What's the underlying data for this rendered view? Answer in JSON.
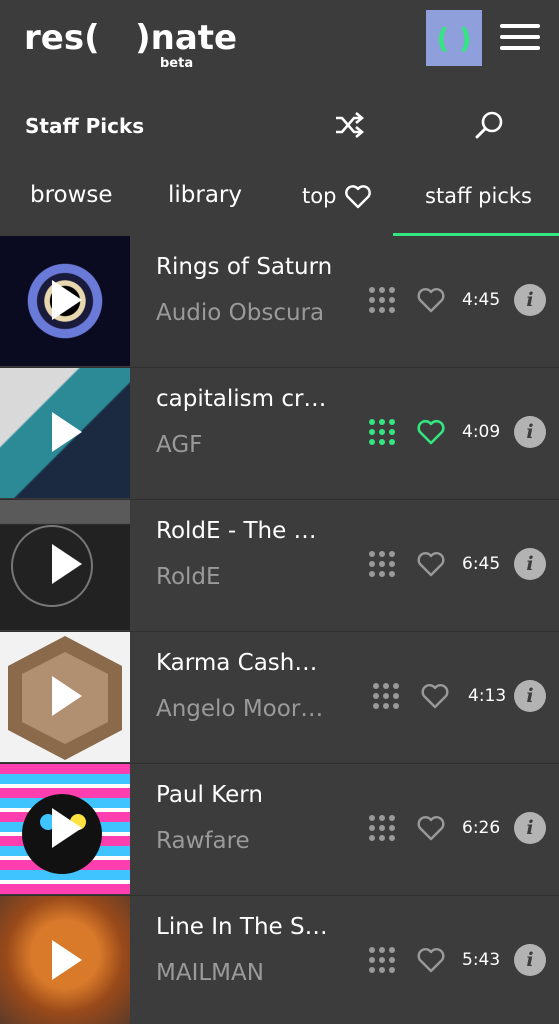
{
  "app": {
    "logo_text": "res(   )nate",
    "beta_label": "beta",
    "player_button_label": "( )"
  },
  "subbar": {
    "title": "Staff Picks"
  },
  "tabs": [
    {
      "label": "browse"
    },
    {
      "label": "library"
    },
    {
      "label": "top"
    },
    {
      "label": "staff picks",
      "active": true
    }
  ],
  "tracks": [
    {
      "title": "Rings of Saturn",
      "artist": "Audio Obscura",
      "duration": "4:45",
      "favorited": false,
      "queued": false
    },
    {
      "title": "capitalism cr…",
      "artist": "AGF",
      "duration": "4:09",
      "favorited": true,
      "queued": true
    },
    {
      "title": "RoldE - The …",
      "artist": "RoldE",
      "duration": "6:45",
      "favorited": false,
      "queued": false
    },
    {
      "title": "Karma Cash…",
      "artist": "Angelo Moor…",
      "duration": "4:13",
      "favorited": false,
      "queued": false
    },
    {
      "title": "Paul Kern",
      "artist": "Rawfare",
      "duration": "6:26",
      "favorited": false,
      "queued": false
    },
    {
      "title": "Line In The S…",
      "artist": "MAILMAN",
      "duration": "5:43",
      "favorited": false,
      "queued": false
    }
  ],
  "info_label": "i",
  "colors": {
    "background": "#3c3c3c",
    "accent_green": "#33e680",
    "player_button": "#8e9fdc",
    "muted_text": "#9a9a9a"
  }
}
